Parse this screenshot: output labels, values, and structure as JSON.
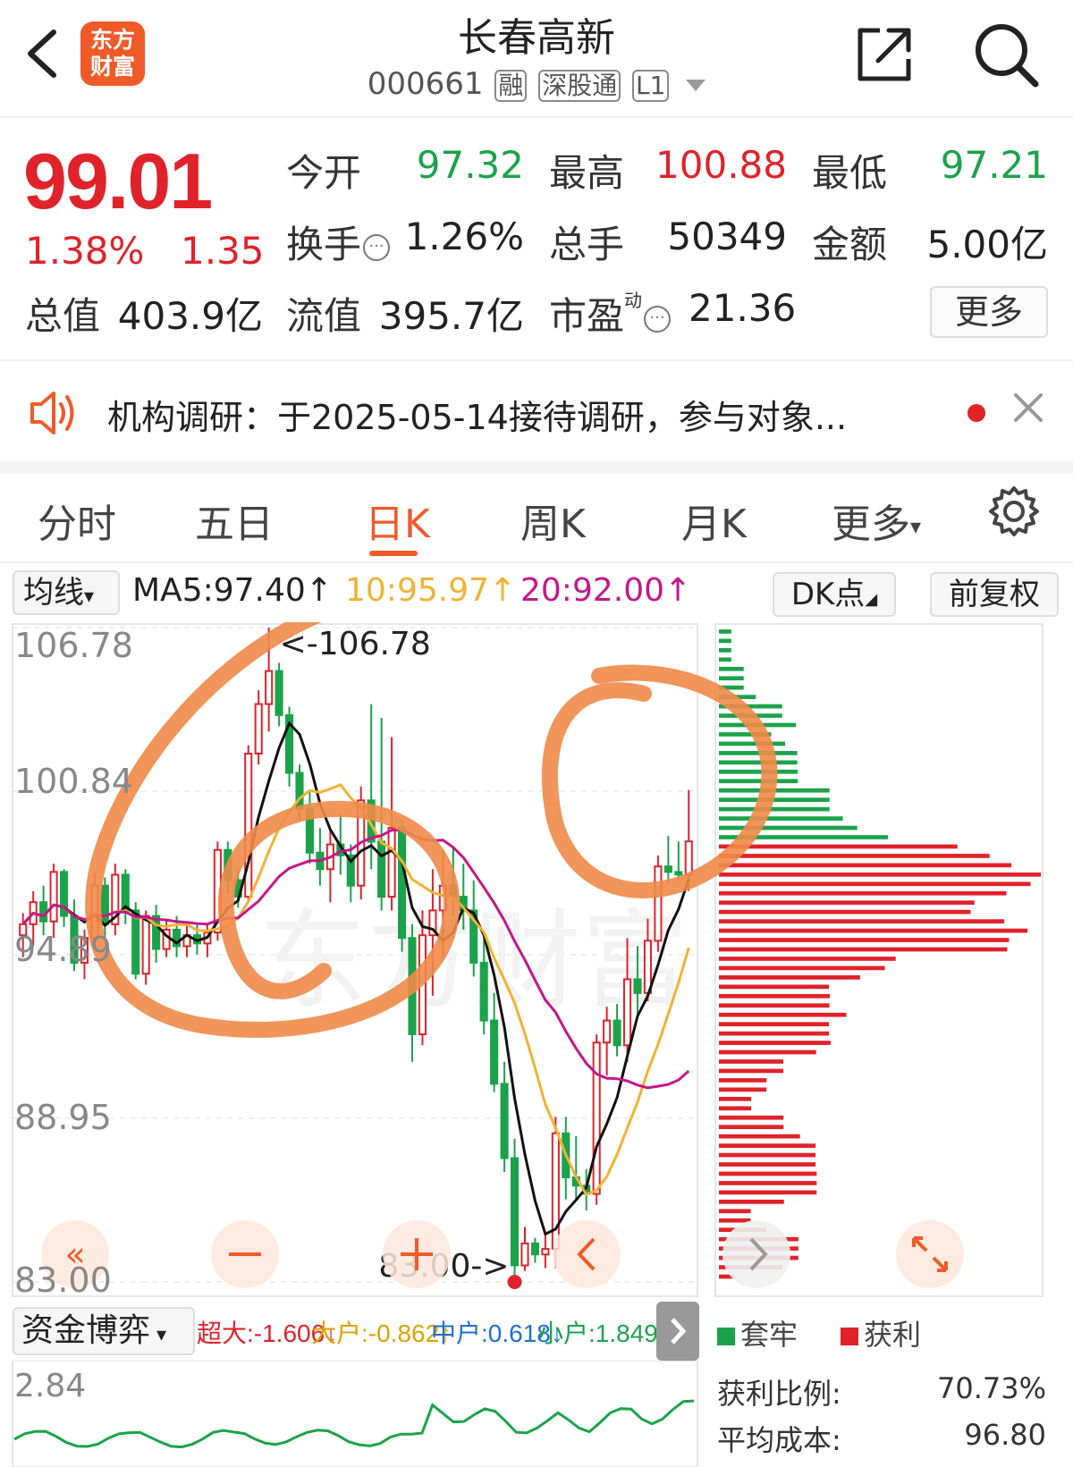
{
  "header": {
    "logo_line1": "东方",
    "logo_line2": "财富",
    "title": "长春高新",
    "code": "000661",
    "tags": [
      "融",
      "深股通",
      "L1"
    ]
  },
  "quote": {
    "price": "99.01",
    "pct": "1.38%",
    "change": "1.35",
    "open_label": "今开",
    "open": "97.32",
    "high_label": "最高",
    "high": "100.88",
    "low_label": "最低",
    "low": "97.21",
    "turnover_label": "换手",
    "turnover": "1.26%",
    "volume_label": "总手",
    "volume": "50349",
    "amount_label": "金额",
    "amount": "5.00亿",
    "mcap_label": "总值",
    "mcap": "403.9亿",
    "float_label": "流值",
    "float": "395.7亿",
    "pe_label": "市盈",
    "pe_sup": "动",
    "pe": "21.36",
    "more": "更多"
  },
  "notice": {
    "text": "机构调研：于2025-05-14接待调研，参与对象..."
  },
  "tabs": [
    "分时",
    "五日",
    "日K",
    "周K",
    "月K",
    "更多"
  ],
  "active_tab": "日K",
  "ma": {
    "selector": "均线",
    "ma5": "MA5:97.40↑",
    "ma10": "10:95.97↑",
    "ma20": "20:92.00↑",
    "dk": "DK点",
    "adjust": "前复权"
  },
  "chart_data": {
    "type": "candlestick",
    "y_ticks": [
      "106.78",
      "100.84",
      "94.89",
      "88.95",
      "83.00"
    ],
    "ylim": [
      83.0,
      106.78
    ],
    "max_label": "<-106.78",
    "min_label": "83.00->",
    "colors": {
      "up": "#e0222a",
      "down": "#1aa34a",
      "ma5": "#111111",
      "ma10": "#f2b233",
      "ma20": "#c5168a"
    },
    "candles": [
      [
        95.6,
        96.4,
        94.8,
        96.0
      ],
      [
        96.0,
        97.2,
        95.2,
        96.8
      ],
      [
        96.8,
        97.4,
        95.6,
        96.1
      ],
      [
        96.1,
        98.2,
        95.5,
        97.9
      ],
      [
        97.9,
        98.0,
        95.9,
        96.3
      ],
      [
        96.3,
        96.9,
        94.3,
        94.6
      ],
      [
        94.6,
        95.8,
        94.0,
        95.5
      ],
      [
        95.5,
        97.9,
        95.2,
        97.4
      ],
      [
        97.4,
        97.7,
        95.5,
        96.0
      ],
      [
        96.0,
        98.2,
        95.6,
        97.8
      ],
      [
        97.8,
        98.0,
        96.0,
        96.5
      ],
      [
        96.5,
        96.8,
        94.0,
        94.2
      ],
      [
        94.2,
        96.5,
        93.8,
        96.3
      ],
      [
        96.3,
        96.7,
        94.6,
        95.1
      ],
      [
        95.1,
        96.2,
        94.8,
        95.8
      ],
      [
        95.8,
        96.3,
        94.8,
        95.2
      ],
      [
        95.2,
        96.0,
        94.8,
        95.6
      ],
      [
        95.6,
        96.0,
        94.9,
        95.3
      ],
      [
        95.3,
        96.0,
        94.8,
        95.7
      ],
      [
        95.7,
        99.0,
        95.4,
        98.7
      ],
      [
        98.7,
        99.0,
        97.1,
        97.6
      ],
      [
        97.6,
        98.0,
        96.6,
        97.0
      ],
      [
        97.0,
        102.5,
        96.8,
        102.2
      ],
      [
        102.2,
        104.5,
        101.8,
        104.0
      ],
      [
        104.0,
        106.78,
        103.0,
        105.2
      ],
      [
        105.2,
        105.5,
        103.2,
        103.6
      ],
      [
        103.6,
        103.9,
        101.0,
        101.5
      ],
      [
        101.5,
        101.8,
        99.8,
        100.2
      ],
      [
        100.2,
        100.9,
        98.2,
        98.6
      ],
      [
        98.6,
        99.5,
        97.4,
        98.0
      ],
      [
        98.0,
        99.4,
        96.8,
        98.9
      ],
      [
        98.9,
        100.0,
        97.8,
        98.5
      ],
      [
        98.5,
        98.9,
        96.8,
        97.4
      ],
      [
        97.4,
        101.0,
        96.9,
        100.5
      ],
      [
        100.5,
        104.0,
        98.0,
        99.0
      ],
      [
        99.0,
        103.5,
        96.5,
        97.0
      ],
      [
        97.0,
        102.8,
        96.5,
        99.5
      ],
      [
        99.5,
        99.8,
        95.0,
        95.5
      ],
      [
        95.5,
        96.0,
        91.0,
        92.0
      ],
      [
        92.0,
        96.5,
        91.6,
        95.6
      ],
      [
        95.6,
        98.0,
        93.4,
        96.5
      ],
      [
        96.5,
        98.7,
        94.8,
        97.4
      ],
      [
        97.4,
        98.8,
        96.3,
        97.0
      ],
      [
        97.0,
        98.2,
        95.8,
        96.5
      ],
      [
        96.5,
        97.6,
        94.1,
        94.6
      ],
      [
        94.6,
        95.7,
        92.0,
        92.5
      ],
      [
        92.5,
        93.5,
        89.9,
        90.2
      ],
      [
        90.2,
        91.0,
        87.0,
        87.5
      ],
      [
        87.5,
        88.2,
        83.0,
        83.6
      ],
      [
        83.6,
        85.0,
        83.4,
        84.4
      ],
      [
        84.4,
        84.6,
        83.7,
        84.0
      ],
      [
        84.0,
        84.8,
        83.5,
        84.2
      ],
      [
        84.2,
        89.0,
        83.5,
        88.4
      ],
      [
        88.4,
        89.0,
        86.0,
        86.8
      ],
      [
        86.8,
        88.3,
        86.0,
        86.5
      ],
      [
        86.5,
        87.1,
        85.6,
        86.2
      ],
      [
        86.2,
        92.0,
        85.8,
        91.7
      ],
      [
        91.7,
        93.0,
        90.5,
        92.5
      ],
      [
        92.5,
        93.1,
        91.2,
        91.6
      ],
      [
        91.6,
        95.5,
        91.0,
        94.0
      ],
      [
        94.0,
        95.2,
        92.6,
        93.5
      ],
      [
        93.5,
        96.2,
        93.2,
        95.4
      ],
      [
        95.4,
        98.5,
        95.0,
        98.1
      ],
      [
        98.1,
        99.2,
        97.5,
        97.9
      ],
      [
        97.9,
        99.0,
        97.6,
        97.8
      ],
      [
        97.8,
        100.88,
        97.21,
        99.01
      ]
    ],
    "chip_profile": {
      "legend_trapped": "套牢",
      "legend_profit": "获利",
      "profit_ratio_label": "获利比例:",
      "profit_ratio": "70.73%",
      "avg_cost_label": "平均成本:",
      "avg_cost": "96.80"
    }
  },
  "fund": {
    "selector": "资金博弈",
    "super": "超大:-1.606↓",
    "large": "大户:-0.862↑",
    "mid": "中户:0.618↓",
    "small": "小户:1.849↓",
    "y_top": "2.84"
  }
}
